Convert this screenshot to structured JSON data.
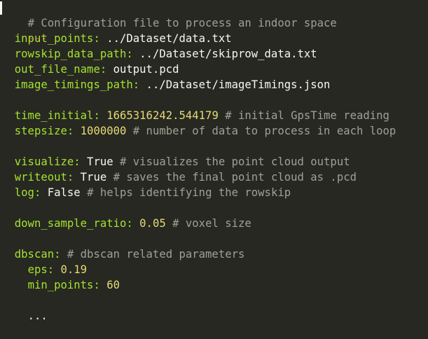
{
  "editor": {
    "header_comment": "# Configuration file to process an indoor space",
    "doc_start": "---",
    "doc_end": "...",
    "entries": {
      "input_points": {
        "key": "input_points:",
        "value": " ../Dataset/data.txt"
      },
      "rowskip_data_path": {
        "key": "rowskip_data_path:",
        "value": " ../Dataset/skiprow_data.txt"
      },
      "out_file_name": {
        "key": "out_file_name:",
        "value": " output.pcd"
      },
      "image_timings_path": {
        "key": "image_timings_path:",
        "value": " ../Dataset/imageTimings.json"
      },
      "time_initial": {
        "key": "time_initial:",
        "value": " 1665316242.544179",
        "comment": " # initial GpsTime reading"
      },
      "stepsize": {
        "key": "stepsize:",
        "value": " 1000000",
        "comment": " # number of data to process in each loop"
      },
      "visualize": {
        "key": "visualize:",
        "value": " True",
        "comment": " # visualizes the point cloud output"
      },
      "writeout": {
        "key": "writeout:",
        "value": " True",
        "comment": " # saves the final point cloud as .pcd"
      },
      "log": {
        "key": "log:",
        "value": " False",
        "comment": " # helps identifying the rowskip"
      },
      "down_sample_ratio": {
        "key": "down_sample_ratio:",
        "value": " 0.05",
        "comment": " # voxel size"
      },
      "dbscan": {
        "key": "dbscan:",
        "comment": " # dbscan related parameters"
      },
      "eps": {
        "key": "eps:",
        "value": " 0.19"
      },
      "min_points": {
        "key": "min_points:",
        "value": " 60"
      }
    }
  },
  "colors": {
    "background": "#272822",
    "key": "#a6e22e",
    "number": "#e6db74",
    "comment": "#a0a094",
    "text": "#f8f8f2",
    "document_marker": "#f92672"
  }
}
